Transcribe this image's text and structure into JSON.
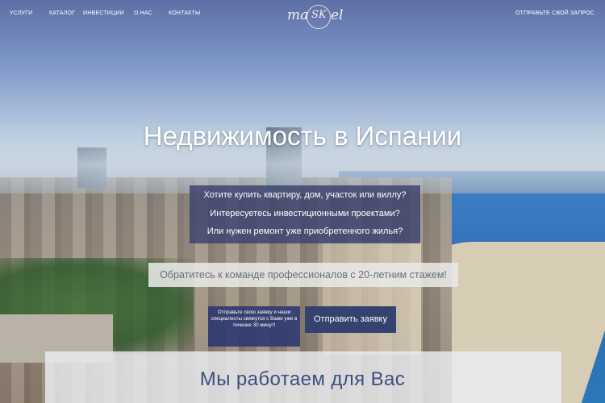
{
  "nav": {
    "items": [
      {
        "label": "УСЛУГИ"
      },
      {
        "label": "КАТАЛОГ"
      },
      {
        "label": "ИНВЕСТИЦИИ"
      },
      {
        "label": "О НАС"
      },
      {
        "label": "КОНТАКТЫ"
      }
    ],
    "request": "ОТПРАВЬТЕ СВОЙ ЗАПРОС"
  },
  "logo": {
    "prefix": "ma",
    "circle": "SK",
    "suffix": "el"
  },
  "hero": {
    "title": "Недвижимость в Испании",
    "questions": [
      "Хотите купить квартиру, дом, участок или виллу?",
      "Интересуетесь инвестиционными проектами?",
      "Или нужен ремонт уже приобретенного жилья?"
    ],
    "expert": "Обратитесь к команде профессионалов с 20-летним стажем!",
    "note": "Отправьте свою заявку и наши специалисты свяжутся с Вами уже в течение 30 минут!",
    "cta": "Отправить заявку"
  },
  "section": {
    "title": "Мы работаем для Вас"
  }
}
